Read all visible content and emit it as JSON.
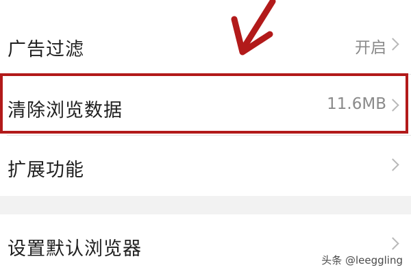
{
  "settings": {
    "rows": [
      {
        "label": "广告过滤",
        "value": "开启"
      },
      {
        "label": "清除浏览数据",
        "value": "11.6MB"
      },
      {
        "label": "扩展功能",
        "value": ""
      },
      {
        "label": "设置默认浏览器",
        "value": ""
      }
    ]
  },
  "annotation": {
    "highlight_color": "#b21a1a"
  },
  "watermark": "头条 @leeggling",
  "icons": {
    "row_chevron": "chevron-right-icon",
    "annotation_arrow": "arrow-pointer-icon"
  }
}
